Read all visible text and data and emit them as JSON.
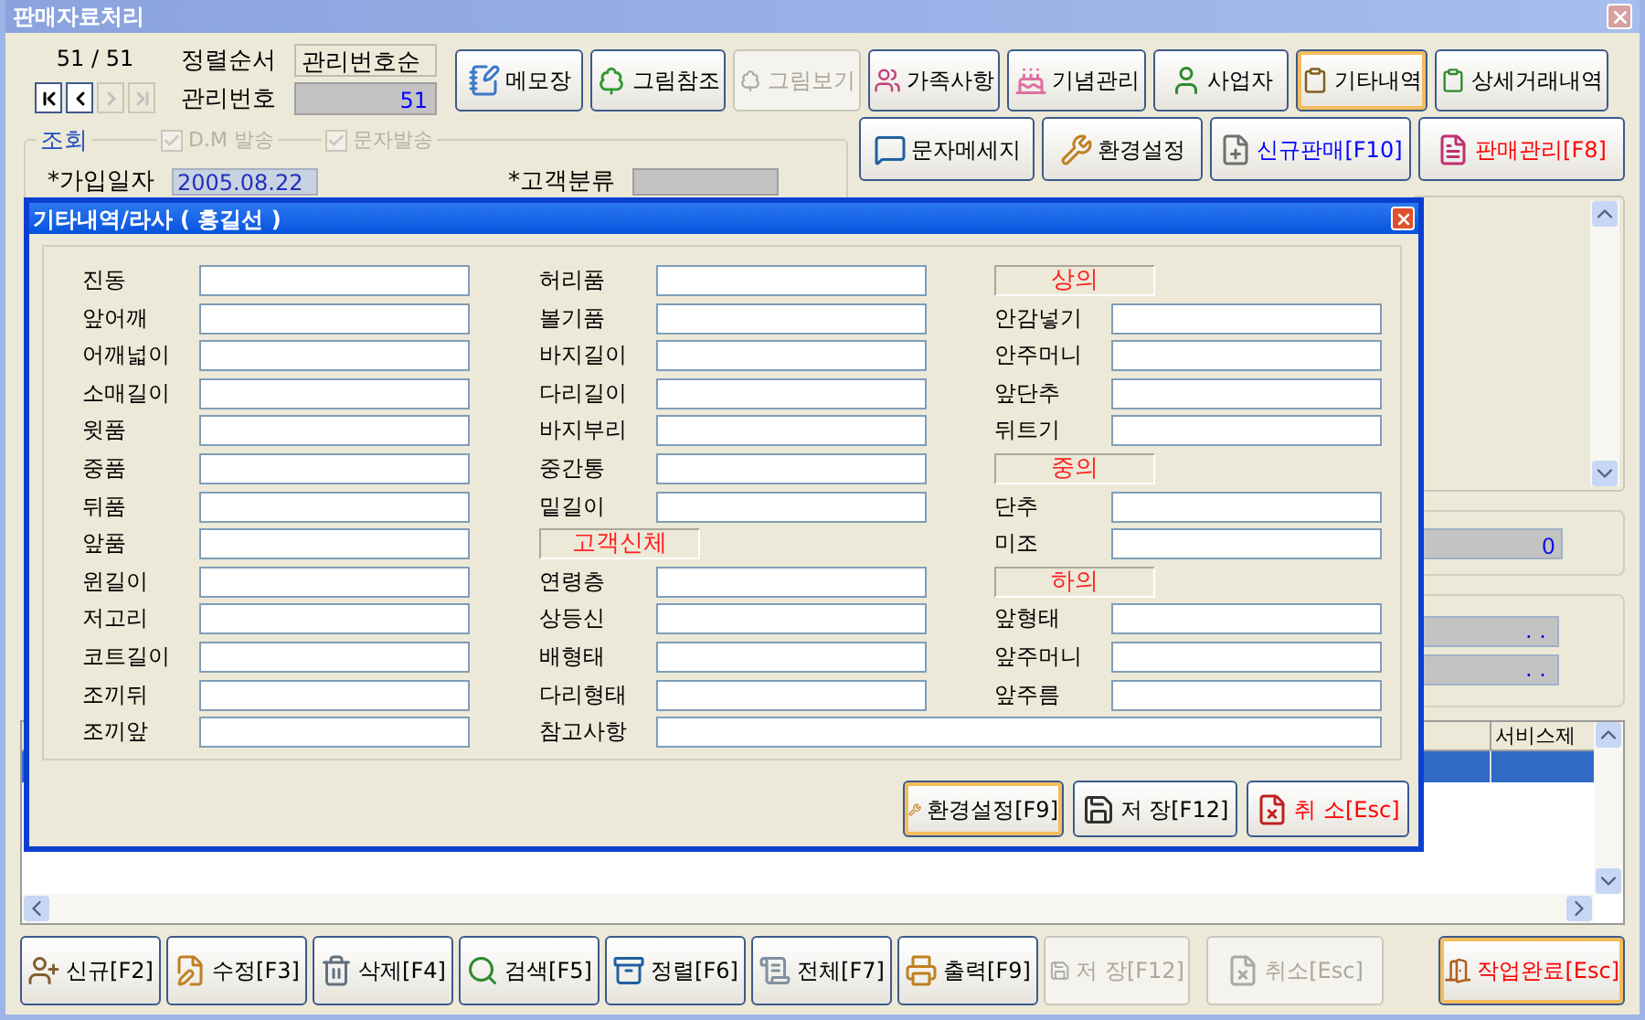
{
  "window": {
    "title": "판매자료처리"
  },
  "record_counter": "51 / 51",
  "nav_buttons": [
    {
      "kind": "first",
      "disabled": false
    },
    {
      "kind": "prev",
      "disabled": false
    },
    {
      "kind": "next",
      "disabled": true
    },
    {
      "kind": "last",
      "disabled": true
    }
  ],
  "sort_order": {
    "label": "정렬순서",
    "value": "관리번호순"
  },
  "record_number": {
    "label": "관리번호",
    "value": "51"
  },
  "toolbar_rows": [
    [
      {
        "label": "메모장",
        "color": "#000000",
        "disabled": false,
        "focused": false
      },
      {
        "label": "그림참조",
        "color": "#000000",
        "disabled": false,
        "focused": false
      },
      {
        "label": "그림보기",
        "color": "#aca899",
        "disabled": true,
        "focused": false
      },
      {
        "label": "가족사항",
        "color": "#000000",
        "disabled": false,
        "focused": false
      },
      {
        "label": "기념관리",
        "color": "#000000",
        "disabled": false,
        "focused": false
      },
      {
        "label": "사업자",
        "color": "#000000",
        "disabled": false,
        "focused": false
      },
      {
        "label": "기타내역",
        "color": "#000000",
        "disabled": false,
        "focused": true
      },
      {
        "label": "상세거래내역",
        "color": "#000000",
        "disabled": false,
        "focused": false
      }
    ],
    [
      {
        "label": "문자메세지",
        "color": "#000000",
        "disabled": false,
        "focused": false
      },
      {
        "label": "환경설정",
        "color": "#000000",
        "disabled": false,
        "focused": false
      },
      {
        "label": "신규판매[F10]",
        "color": "#0000ff",
        "disabled": false,
        "focused": false
      },
      {
        "label": "판매관리[F8]",
        "color": "#ff0000",
        "disabled": false,
        "focused": false
      }
    ]
  ],
  "query_group": {
    "title": "조회",
    "checkboxes": [
      {
        "label": "D.M 발송",
        "checked": true,
        "disabled": true
      },
      {
        "label": "문자발송",
        "checked": true,
        "disabled": true
      }
    ],
    "join_date": {
      "label": "*가입일자",
      "value": "2005.08.22"
    },
    "customer_class": {
      "label": "*고객분류"
    }
  },
  "side_panel": {
    "amount": "0",
    "dates": [
      ". .",
      ". ."
    ]
  },
  "table": {
    "columns": [
      "서비스제"
    ],
    "rows": [
      {
        "selected": true
      }
    ]
  },
  "bottom_toolbar": [
    {
      "label": "신규[F2]",
      "color": "#000000",
      "disabled": false,
      "focused": false
    },
    {
      "label": "수정[F3]",
      "color": "#000000",
      "disabled": false,
      "focused": false
    },
    {
      "label": "삭제[F4]",
      "color": "#000000",
      "disabled": false,
      "focused": false
    },
    {
      "label": "검색[F5]",
      "color": "#000000",
      "disabled": false,
      "focused": false
    },
    {
      "label": "정렬[F6]",
      "color": "#000000",
      "disabled": false,
      "focused": false
    },
    {
      "label": "전체[F7]",
      "color": "#000000",
      "disabled": false,
      "focused": false
    },
    {
      "label": "출력[F9]",
      "color": "#000000",
      "disabled": false,
      "focused": false
    },
    {
      "label": "저 장[F12]",
      "color": "#aca899",
      "disabled": true,
      "focused": false
    },
    {
      "label": "취소[Esc]",
      "color": "#aca899",
      "disabled": true,
      "focused": false
    },
    {
      "label": "작업완료[Esc]",
      "color": "#ff0000",
      "disabled": false,
      "focused": true
    }
  ],
  "dialog": {
    "title": "기타내역/라사 ( 홍길선 )",
    "columns": [
      [
        {
          "kind": "field",
          "label": "진동"
        },
        {
          "kind": "field",
          "label": "앞어깨"
        },
        {
          "kind": "field",
          "label": "어깨넓이"
        },
        {
          "kind": "field",
          "label": "소매길이"
        },
        {
          "kind": "field",
          "label": "윗품"
        },
        {
          "kind": "field",
          "label": "중품"
        },
        {
          "kind": "field",
          "label": "뒤품"
        },
        {
          "kind": "field",
          "label": "앞품"
        },
        {
          "kind": "field",
          "label": "윈길이"
        },
        {
          "kind": "field",
          "label": "저고리"
        },
        {
          "kind": "field",
          "label": "코트길이"
        },
        {
          "kind": "field",
          "label": "조끼뒤"
        },
        {
          "kind": "field",
          "label": "조끼앞"
        }
      ],
      [
        {
          "kind": "field",
          "label": "허리품"
        },
        {
          "kind": "field",
          "label": "볼기품"
        },
        {
          "kind": "field",
          "label": "바지길이"
        },
        {
          "kind": "field",
          "label": "다리길이"
        },
        {
          "kind": "field",
          "label": "바지부리"
        },
        {
          "kind": "field",
          "label": "중간통"
        },
        {
          "kind": "field",
          "label": "밑길이"
        },
        {
          "kind": "section",
          "label": "고객신체"
        },
        {
          "kind": "field",
          "label": "연령층"
        },
        {
          "kind": "field",
          "label": "상등신"
        },
        {
          "kind": "field",
          "label": "배형태"
        },
        {
          "kind": "field",
          "label": "다리형태"
        },
        {
          "kind": "wide_field",
          "label": "참고사항"
        }
      ],
      [
        {
          "kind": "section",
          "label": "상의"
        },
        {
          "kind": "field",
          "label": "안감넣기"
        },
        {
          "kind": "field",
          "label": "안주머니"
        },
        {
          "kind": "field",
          "label": "앞단추"
        },
        {
          "kind": "field",
          "label": "뒤트기"
        },
        {
          "kind": "section",
          "label": "중의"
        },
        {
          "kind": "field",
          "label": "단추"
        },
        {
          "kind": "field",
          "label": "미조"
        },
        {
          "kind": "section",
          "label": "하의"
        },
        {
          "kind": "field",
          "label": "앞형태"
        },
        {
          "kind": "field",
          "label": "앞주머니"
        },
        {
          "kind": "field",
          "label": "앞주름"
        }
      ]
    ],
    "buttons": [
      {
        "label": "환경설정[F9]",
        "color": "#000000",
        "disabled": false,
        "focused": true
      },
      {
        "label": "저 장[F12]",
        "color": "#000000",
        "disabled": false,
        "focused": false
      },
      {
        "label": "취 소[Esc]",
        "color": "#ff0000",
        "disabled": false,
        "focused": false
      }
    ]
  }
}
